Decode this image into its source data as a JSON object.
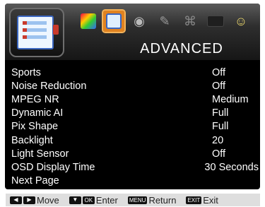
{
  "header": {
    "title": "ADVANCED",
    "tabs": [
      {
        "icon": "picture-icon",
        "active": false
      },
      {
        "icon": "advanced-icon",
        "active": true
      },
      {
        "icon": "sound-icon",
        "active": false
      },
      {
        "icon": "setup-icon",
        "active": false
      },
      {
        "icon": "lock-icon",
        "active": false
      },
      {
        "icon": "channel-icon",
        "active": false
      },
      {
        "icon": "smile-icon",
        "active": false
      }
    ]
  },
  "menu": {
    "items": [
      {
        "label": "Sports",
        "value": "Off"
      },
      {
        "label": "Noise Reduction",
        "value": "Off"
      },
      {
        "label": "MPEG NR",
        "value": "Medium"
      },
      {
        "label": "Dynamic AI",
        "value": "Full"
      },
      {
        "label": "Pix Shape",
        "value": "Full"
      },
      {
        "label": "Backlight",
        "value": "20"
      },
      {
        "label": "Light Sensor",
        "value": "Off"
      },
      {
        "label": "OSD Display Time",
        "value": "30 Seconds"
      },
      {
        "label": "Next Page",
        "value": ""
      }
    ]
  },
  "help": {
    "move": {
      "label": "Move"
    },
    "enter": {
      "key": "OK",
      "label": "Enter"
    },
    "return": {
      "key": "MENU",
      "label": "Return"
    },
    "exit": {
      "key": "EXIT",
      "label": "Exit"
    }
  },
  "colors": {
    "accent": "#e08220",
    "background": "#000000",
    "text": "#ffffff",
    "help_bar": "#dedede"
  }
}
